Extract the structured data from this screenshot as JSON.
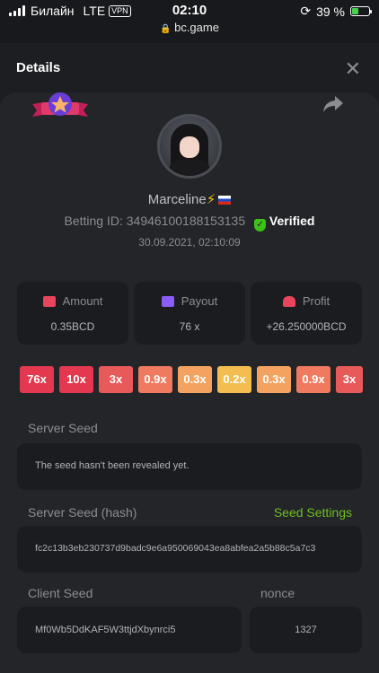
{
  "status_bar": {
    "carrier": "Билайн",
    "network": "LTE",
    "vpn": "VPN",
    "time": "02:10",
    "url": "bc.game",
    "battery_percent": "39 %",
    "battery_level": 0.39
  },
  "header": {
    "title": "Details",
    "close_icon": "✕"
  },
  "profile": {
    "username": "Marceline",
    "betting_id_label": "Betting ID:",
    "betting_id": "34946100188153135",
    "verified_label": "Verified",
    "date": "30.09.2021, 02:10:09"
  },
  "stats": [
    {
      "label": "Amount",
      "value": "0.35BCD",
      "color": "#e8455d"
    },
    {
      "label": "Payout",
      "value": "76 x",
      "color": "#8b5cf6"
    },
    {
      "label": "Profit",
      "value": "+26.250000BCD",
      "color": "#e8455d"
    }
  ],
  "multipliers": [
    {
      "label": "76x",
      "color": "#e3384f"
    },
    {
      "label": "10x",
      "color": "#e3384f"
    },
    {
      "label": "3x",
      "color": "#e8595a"
    },
    {
      "label": "0.9x",
      "color": "#ef7a5f"
    },
    {
      "label": "0.3x",
      "color": "#f3a25f"
    },
    {
      "label": "0.2x",
      "color": "#f4bd4f"
    },
    {
      "label": "0.3x",
      "color": "#f3a25f"
    },
    {
      "label": "0.9x",
      "color": "#ef7a5f"
    },
    {
      "label": "3x",
      "color": "#e8595a"
    }
  ],
  "server_seed": {
    "label": "Server Seed",
    "value": "The seed hasn't been revealed yet."
  },
  "server_seed_hash": {
    "label": "Server Seed (hash)",
    "settings_link": "Seed Settings",
    "value": "fc2c13b3eb230737d9badc9e6a950069043ea8abfea2a5b88c5a7c3"
  },
  "client_seed": {
    "label": "Client Seed",
    "value": "Mf0Wb5DdKAF5W3ttjdXbynrci5"
  },
  "nonce": {
    "label": "nonce",
    "value": "1327"
  }
}
